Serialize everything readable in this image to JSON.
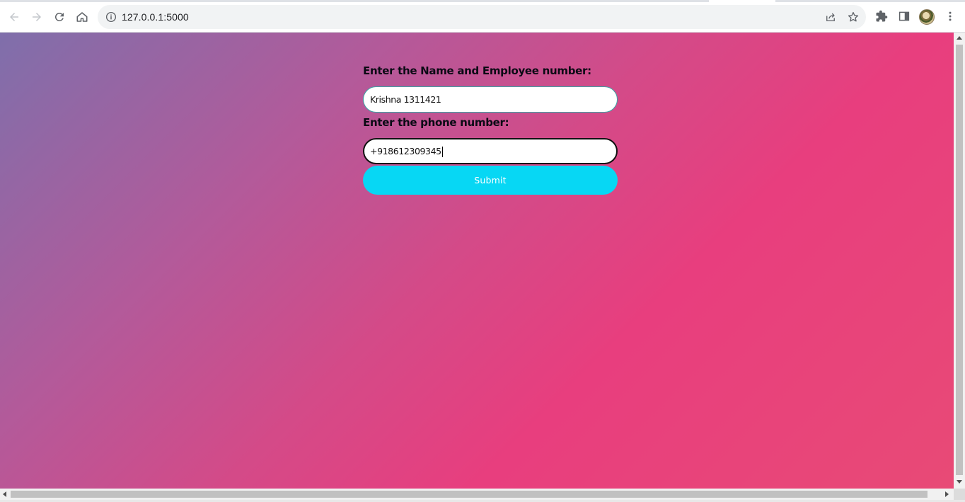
{
  "browser": {
    "url": "127.0.0.1:5000",
    "colors": {
      "chrome_bg": "#ffffff",
      "omnibox_bg": "#f1f3f4",
      "icon": "#5f6368"
    },
    "icons": [
      "back-arrow-icon",
      "forward-arrow-icon",
      "reload-icon",
      "home-icon",
      "site-info-icon",
      "share-icon",
      "bookmark-star-icon",
      "extensions-puzzle-icon",
      "side-panel-icon",
      "profile-avatar",
      "more-menu-icon"
    ]
  },
  "form": {
    "name_label": "Enter the Name and Employee number:",
    "name_value": "Krishna 1311421",
    "phone_label": "Enter the phone number:",
    "phone_value": "+918612309345",
    "submit_label": "Submit"
  },
  "theme": {
    "gradient_start": "#7f6fab",
    "gradient_mid": "#e83e7e",
    "gradient_end": "#e84a76",
    "button_color": "#07d7f4",
    "field_border": "#3aa6a6"
  }
}
